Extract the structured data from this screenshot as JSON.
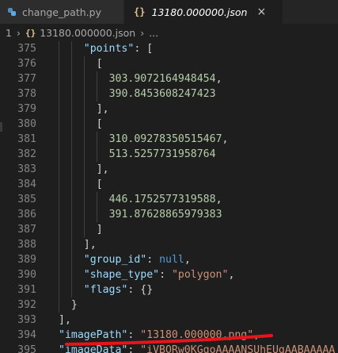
{
  "tabs": [
    {
      "label": "change_path.py",
      "icon": "python-file-icon",
      "active": false
    },
    {
      "label": "13180.000000.json",
      "icon": "json-file-icon",
      "active": true,
      "close": "×"
    }
  ],
  "breadcrumb": {
    "root": "1",
    "file": "13180.000000.json",
    "more": "..."
  },
  "editor": {
    "lines": [
      {
        "n": "375",
        "indent": 6,
        "tokens": [
          {
            "t": "k",
            "v": "\"points\""
          },
          {
            "t": "p",
            "v": ": ["
          }
        ]
      },
      {
        "n": "376",
        "indent": 8,
        "tokens": [
          {
            "t": "p",
            "v": "["
          }
        ]
      },
      {
        "n": "377",
        "indent": 10,
        "tokens": [
          {
            "t": "n",
            "v": "303.9072164948454"
          },
          {
            "t": "p",
            "v": ","
          }
        ]
      },
      {
        "n": "378",
        "indent": 10,
        "tokens": [
          {
            "t": "n",
            "v": "390.8453608247423"
          }
        ]
      },
      {
        "n": "379",
        "indent": 8,
        "tokens": [
          {
            "t": "p",
            "v": "],"
          }
        ]
      },
      {
        "n": "380",
        "indent": 8,
        "tokens": [
          {
            "t": "p",
            "v": "["
          }
        ]
      },
      {
        "n": "381",
        "indent": 10,
        "tokens": [
          {
            "t": "n",
            "v": "310.09278350515467"
          },
          {
            "t": "p",
            "v": ","
          }
        ]
      },
      {
        "n": "382",
        "indent": 10,
        "tokens": [
          {
            "t": "n",
            "v": "513.5257731958764"
          }
        ]
      },
      {
        "n": "383",
        "indent": 8,
        "tokens": [
          {
            "t": "p",
            "v": "],"
          }
        ]
      },
      {
        "n": "384",
        "indent": 8,
        "tokens": [
          {
            "t": "p",
            "v": "["
          }
        ]
      },
      {
        "n": "385",
        "indent": 10,
        "tokens": [
          {
            "t": "n",
            "v": "446.1752577319588"
          },
          {
            "t": "p",
            "v": ","
          }
        ]
      },
      {
        "n": "386",
        "indent": 10,
        "tokens": [
          {
            "t": "n",
            "v": "391.87628865979383"
          }
        ]
      },
      {
        "n": "387",
        "indent": 8,
        "tokens": [
          {
            "t": "p",
            "v": "]"
          }
        ]
      },
      {
        "n": "388",
        "indent": 6,
        "tokens": [
          {
            "t": "p",
            "v": "],"
          }
        ]
      },
      {
        "n": "389",
        "indent": 6,
        "tokens": [
          {
            "t": "k",
            "v": "\"group_id\""
          },
          {
            "t": "p",
            "v": ": "
          },
          {
            "t": "c",
            "v": "null"
          },
          {
            "t": "p",
            "v": ","
          }
        ]
      },
      {
        "n": "390",
        "indent": 6,
        "tokens": [
          {
            "t": "k",
            "v": "\"shape_type\""
          },
          {
            "t": "p",
            "v": ": "
          },
          {
            "t": "s",
            "v": "\"polygon\""
          },
          {
            "t": "p",
            "v": ","
          }
        ]
      },
      {
        "n": "391",
        "indent": 6,
        "tokens": [
          {
            "t": "k",
            "v": "\"flags\""
          },
          {
            "t": "p",
            "v": ": {}"
          }
        ]
      },
      {
        "n": "392",
        "indent": 4,
        "tokens": [
          {
            "t": "p",
            "v": "}"
          }
        ]
      },
      {
        "n": "393",
        "indent": 2,
        "tokens": [
          {
            "t": "p",
            "v": "],"
          }
        ]
      },
      {
        "n": "394",
        "indent": 2,
        "tokens": [
          {
            "t": "k",
            "v": "\"imagePath\""
          },
          {
            "t": "p",
            "v": ": "
          },
          {
            "t": "s",
            "v": "\"13180.000000.png\""
          },
          {
            "t": "p",
            "v": ","
          }
        ]
      },
      {
        "n": "395",
        "indent": 2,
        "tokens": [
          {
            "t": "k",
            "v": "\"imageData\""
          },
          {
            "t": "p",
            "v": ": "
          },
          {
            "t": "s",
            "v": "\"iVBORw0KGgoAAAANSUhEUgAABAAAAA"
          }
        ]
      }
    ]
  },
  "colors": {
    "annotation_underline": "#e8141c"
  }
}
